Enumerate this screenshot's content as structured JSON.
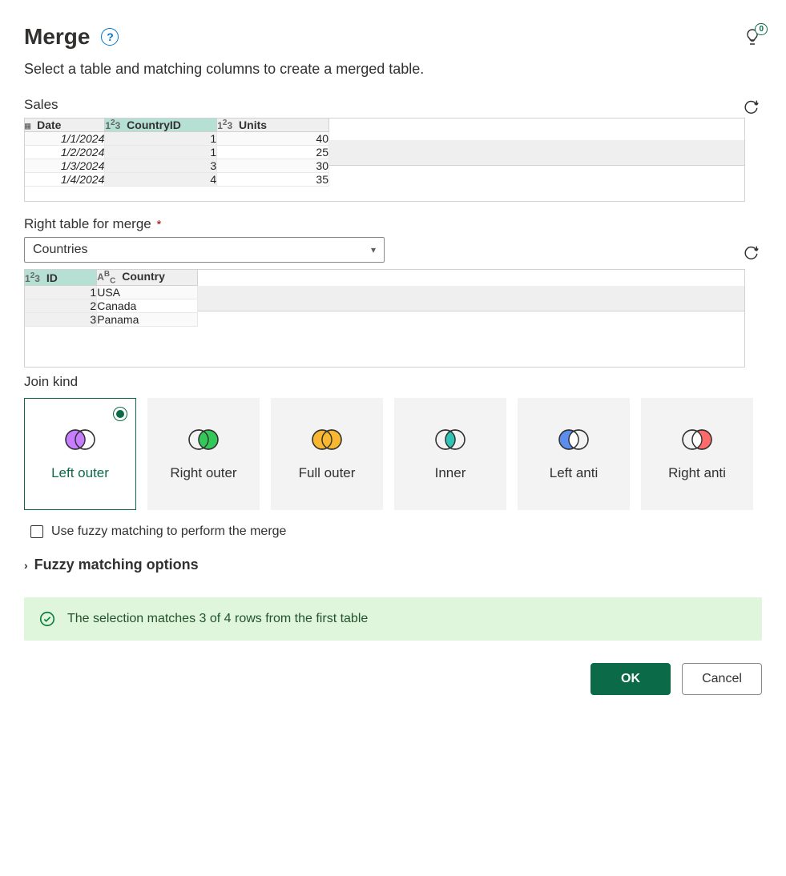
{
  "header": {
    "title": "Merge",
    "help_tooltip": "?",
    "bulb_badge": "0"
  },
  "subtitle": "Select a table and matching columns to create a merged table.",
  "left_table": {
    "name": "Sales",
    "columns": [
      {
        "label": "Date",
        "type": "date",
        "selected": false
      },
      {
        "label": "CountryID",
        "type": "number",
        "selected": true
      },
      {
        "label": "Units",
        "type": "number",
        "selected": false
      }
    ],
    "rows": [
      {
        "Date": "1/1/2024",
        "CountryID": "1",
        "Units": "40"
      },
      {
        "Date": "1/2/2024",
        "CountryID": "1",
        "Units": "25"
      },
      {
        "Date": "1/3/2024",
        "CountryID": "3",
        "Units": "30"
      },
      {
        "Date": "1/4/2024",
        "CountryID": "4",
        "Units": "35"
      }
    ]
  },
  "right_table_field": {
    "label": "Right table for merge",
    "required_mark": "*",
    "selected": "Countries"
  },
  "right_table": {
    "columns": [
      {
        "label": "ID",
        "type": "number",
        "selected": true
      },
      {
        "label": "Country",
        "type": "text",
        "selected": false
      }
    ],
    "rows": [
      {
        "ID": "1",
        "Country": "USA"
      },
      {
        "ID": "2",
        "Country": "Canada"
      },
      {
        "ID": "3",
        "Country": "Panama"
      }
    ]
  },
  "join_kind": {
    "label": "Join kind",
    "options": [
      {
        "key": "left_outer",
        "label": "Left outer",
        "venn": "left"
      },
      {
        "key": "right_outer",
        "label": "Right outer",
        "venn": "right"
      },
      {
        "key": "full_outer",
        "label": "Full outer",
        "venn": "full"
      },
      {
        "key": "inner",
        "label": "Inner",
        "venn": "inner"
      },
      {
        "key": "left_anti",
        "label": "Left anti",
        "venn": "leftanti"
      },
      {
        "key": "right_anti",
        "label": "Right anti",
        "venn": "rightanti"
      }
    ],
    "selected": "left_outer"
  },
  "fuzzy": {
    "checkbox_label": "Use fuzzy matching to perform the merge",
    "checked": false,
    "options_label": "Fuzzy matching options"
  },
  "match_banner": "The selection matches 3 of 4 rows from the first table",
  "buttons": {
    "ok": "OK",
    "cancel": "Cancel"
  }
}
